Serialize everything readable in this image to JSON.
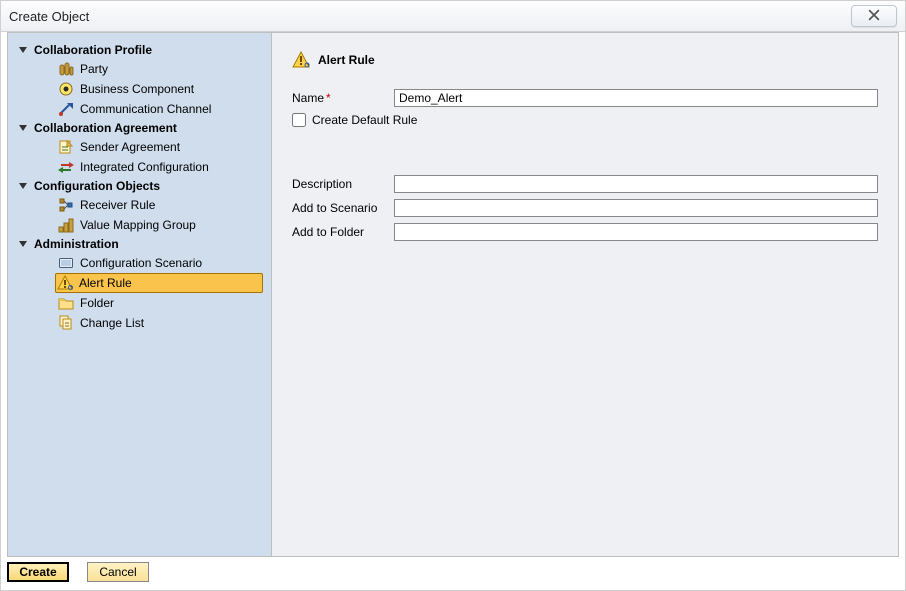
{
  "window": {
    "title": "Create Object"
  },
  "sidebar": {
    "sections": [
      {
        "label": "Collaboration Profile",
        "items": [
          {
            "icon": "party-icon",
            "label": "Party"
          },
          {
            "icon": "business-component-icon",
            "label": "Business Component"
          },
          {
            "icon": "communication-channel-icon",
            "label": "Communication Channel"
          }
        ]
      },
      {
        "label": "Collaboration Agreement",
        "items": [
          {
            "icon": "sender-agreement-icon",
            "label": "Sender Agreement"
          },
          {
            "icon": "integrated-configuration-icon",
            "label": "Integrated Configuration"
          }
        ]
      },
      {
        "label": "Configuration Objects",
        "items": [
          {
            "icon": "receiver-rule-icon",
            "label": "Receiver Rule"
          },
          {
            "icon": "value-mapping-group-icon",
            "label": "Value Mapping Group"
          }
        ]
      },
      {
        "label": "Administration",
        "items": [
          {
            "icon": "configuration-scenario-icon",
            "label": "Configuration Scenario"
          },
          {
            "icon": "alert-rule-icon",
            "label": "Alert Rule",
            "selected": true
          },
          {
            "icon": "folder-icon",
            "label": "Folder"
          },
          {
            "icon": "change-list-icon",
            "label": "Change List"
          }
        ]
      }
    ]
  },
  "main": {
    "heading": "Alert Rule",
    "heading_icon": "alert-rule-icon",
    "fields": {
      "name": {
        "label": "Name",
        "required": true,
        "value": "Demo_Alert"
      },
      "createDefault": {
        "label": "Create Default Rule",
        "checked": false
      },
      "description": {
        "label": "Description",
        "value": ""
      },
      "addToScenario": {
        "label": "Add to Scenario",
        "value": ""
      },
      "addToFolder": {
        "label": "Add to Folder",
        "value": ""
      }
    }
  },
  "footer": {
    "create": "Create",
    "cancel": "Cancel"
  }
}
